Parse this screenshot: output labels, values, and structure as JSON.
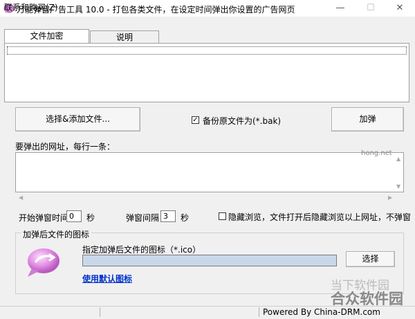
{
  "window": {
    "title": "万能弹窗广告工具 10.0 - 打包各类文件，在设定时间弹出你设置的广告网页",
    "minimize": "—",
    "maximize": "☐",
    "close": "✕"
  },
  "menu": {
    "contact": "联系和购买(Z)"
  },
  "tabs": [
    {
      "label": "文件加密",
      "active": true
    },
    {
      "label": "说明",
      "active": false
    }
  ],
  "actions": {
    "select_add": "选择&添加文件...",
    "encrypt": "加弹",
    "choose": "选择"
  },
  "backup": {
    "checked": true,
    "label": "备份原文件为(*.bak)"
  },
  "urls": {
    "label": "要弹出的网址，每行一条：",
    "value": ""
  },
  "timing": {
    "start_label": "开始弹窗时间",
    "start_value": "0",
    "start_unit": "秒",
    "interval_label": "弹窗间隔",
    "interval_value": "3",
    "interval_unit": "秒"
  },
  "hide": {
    "checked": false,
    "label": "隐藏浏览，文件打开后隐藏浏览以上网址，不弹窗"
  },
  "icon_group": {
    "title": "加弹后文件的图标",
    "path_label": "指定加弹后文件的图标（*.ico）",
    "path_value": "",
    "default_link": "使用默认图标"
  },
  "status": {
    "powered": "Powered By China-DRM.com"
  },
  "watermark": {
    "top": "当下软件园",
    "main": "合众软件园",
    "small": "hong.net"
  },
  "colors": {
    "link": "#0033cc",
    "path_input_bg": "#c8d8ea"
  }
}
